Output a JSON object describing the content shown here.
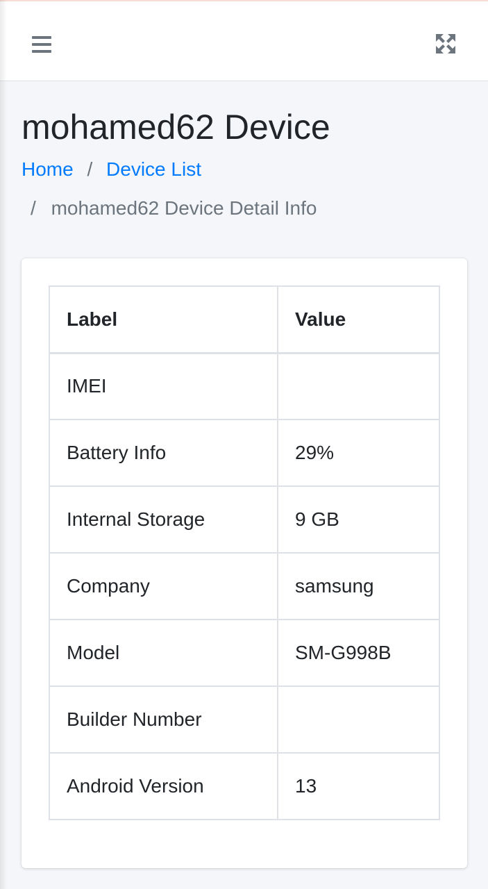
{
  "header": {
    "menu_icon": "hamburger-icon",
    "fullscreen_icon": "expand-arrows-icon"
  },
  "page": {
    "title": "mohamed62 Device"
  },
  "breadcrumb": {
    "home": "Home",
    "separator": "/",
    "device_list": "Device List",
    "current": "mohamed62 Device Detail Info"
  },
  "table": {
    "headers": [
      "Label",
      "Value"
    ],
    "rows": [
      {
        "label": "IMEI",
        "value": ""
      },
      {
        "label": "Battery Info",
        "value": "29%"
      },
      {
        "label": "Internal Storage",
        "value": "9 GB"
      },
      {
        "label": "Company",
        "value": "samsung"
      },
      {
        "label": "Model",
        "value": "SM-G998B"
      },
      {
        "label": "Builder Number",
        "value": ""
      },
      {
        "label": "Android Version",
        "value": "13"
      }
    ]
  },
  "colors": {
    "link": "#007bff",
    "muted": "#6c757d",
    "background": "#f4f6f9"
  }
}
